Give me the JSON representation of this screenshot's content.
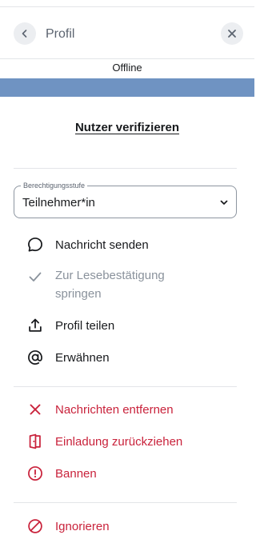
{
  "header": {
    "title": "Profil",
    "back_icon": "chevron-left-icon",
    "close_icon": "close-icon"
  },
  "presence": {
    "status": "Offline",
    "status_color": "#6f93c2"
  },
  "verify": {
    "label": "Nutzer verifizieren"
  },
  "role": {
    "legend": "Berechtigungsstufe",
    "value": "Teilnehmer*in"
  },
  "actions": [
    {
      "label": "Nachricht senden",
      "icon": "chat-bubble-icon",
      "enabled": true
    },
    {
      "label": "Zur Lesebestätigung springen",
      "line1": "Zur Lesebestätigung",
      "line2": "springen",
      "icon": "checkmark-icon",
      "enabled": false
    },
    {
      "label": "Profil teilen",
      "icon": "share-icon",
      "enabled": true
    },
    {
      "label": "Erwähnen",
      "icon": "at-sign-icon",
      "enabled": true
    }
  ],
  "danger_actions": [
    {
      "label": "Nachrichten entfernen",
      "icon": "remove-x-icon"
    },
    {
      "label": "Einladung zurückziehen",
      "icon": "door-exit-icon"
    },
    {
      "label": "Bannen",
      "icon": "alert-circle-icon"
    }
  ],
  "ignore": {
    "label": "Ignorieren",
    "icon": "block-icon"
  },
  "colors": {
    "danger": "#c9223b",
    "muted": "#8a929c",
    "text": "#17191c"
  }
}
